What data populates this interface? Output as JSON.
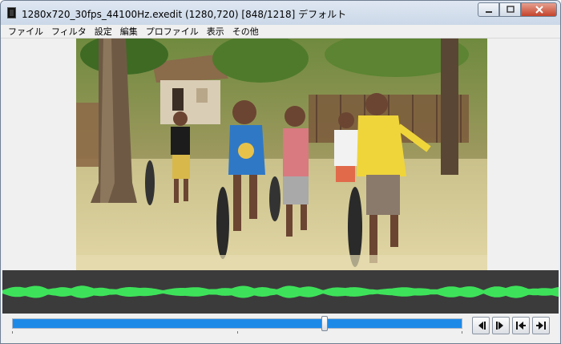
{
  "window": {
    "title": "1280x720_30fps_44100Hz.exedit (1280,720)  [848/1218]  デフォルト",
    "buttons": {
      "minimize": "minimize",
      "maximize": "maximize",
      "close": "close"
    }
  },
  "menu": {
    "items": [
      {
        "label": "ファイル"
      },
      {
        "label": "フィルタ"
      },
      {
        "label": "設定"
      },
      {
        "label": "編集"
      },
      {
        "label": "プロファイル"
      },
      {
        "label": "表示"
      },
      {
        "label": "その他"
      }
    ]
  },
  "player": {
    "current_frame": 848,
    "total_frames": 1218,
    "progress": 0.696
  },
  "controls": {
    "prev_frame": "prev-frame",
    "next_frame": "next-frame",
    "go_start": "go-start",
    "go_end": "go-end"
  },
  "colors": {
    "seek_fill": "#1e8ae8",
    "waveform": "#3ee25a",
    "waveform_bg": "#3b3b3b"
  }
}
